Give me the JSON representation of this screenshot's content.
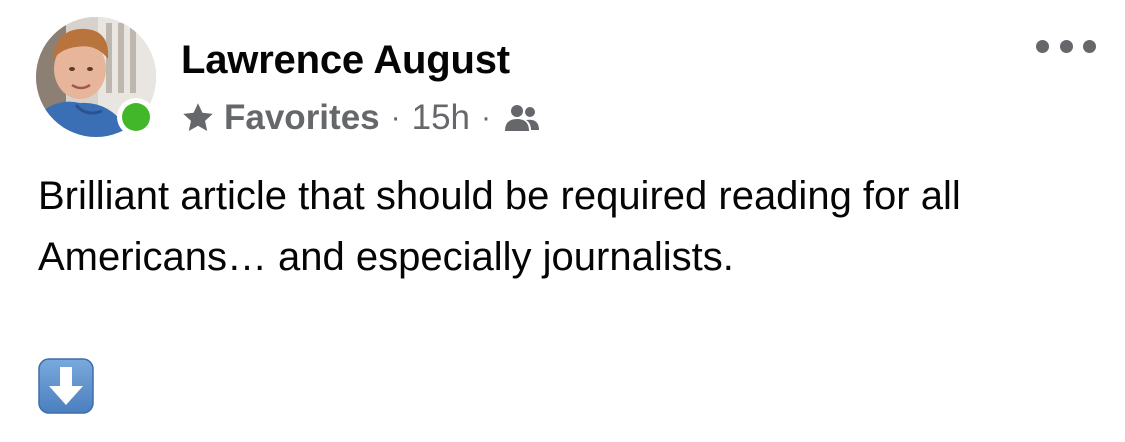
{
  "post": {
    "author": "Lawrence August",
    "audience": "Favorites",
    "separator": "·",
    "time": "15h",
    "body": "Brilliant article that should be required reading for all Americans… and especially journalists.",
    "online": true
  },
  "icons": {
    "star": "star-icon",
    "audience": "friends-icon",
    "more": "more-options-icon",
    "emoji": "down-arrow-emoji-icon"
  },
  "colors": {
    "name": "#050505",
    "meta": "#65676b",
    "online": "#42b72a",
    "emoji_bg": "#5b8ec8"
  }
}
